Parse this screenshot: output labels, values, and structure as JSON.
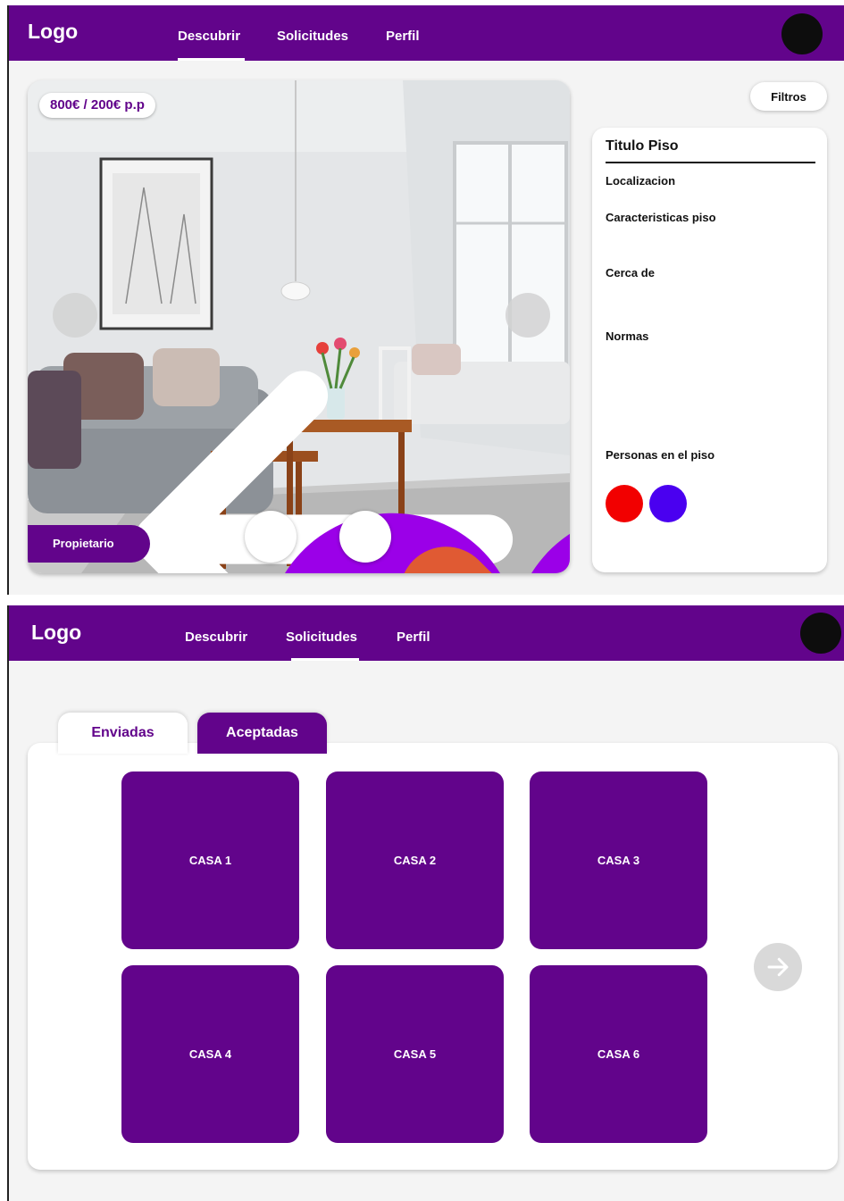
{
  "screen1": {
    "header": {
      "logo": "Logo",
      "tabs": [
        {
          "label": "Descubrir",
          "active": true
        },
        {
          "label": "Solicitudes",
          "active": false
        },
        {
          "label": "Perfil",
          "active": false
        }
      ]
    },
    "listing": {
      "price": "800€ / 200€ p.p",
      "owner_label": "Propietario",
      "like_icon": "heart-icon",
      "dislike_icon": "close-icon"
    },
    "filters_label": "Filtros",
    "details": {
      "title": "Titulo Piso",
      "location": "Localizacion",
      "features": "Caracteristicas piso",
      "nearby": "Cerca de",
      "rules": "Normas",
      "people": "Personas en el piso",
      "people_colors": [
        "#f20000",
        "#4a00f0"
      ]
    }
  },
  "screen2": {
    "header": {
      "logo": "Logo",
      "tabs": [
        {
          "label": "Descubrir",
          "active": false
        },
        {
          "label": "Solicitudes",
          "active": true
        },
        {
          "label": "Perfil",
          "active": false
        }
      ]
    },
    "subtabs": [
      {
        "label": "Enviadas",
        "active": true
      },
      {
        "label": "Aceptadas",
        "active": false
      }
    ],
    "houses": [
      "CASA 1",
      "CASA 2",
      "CASA 3",
      "CASA 4",
      "CASA 5",
      "CASA 6"
    ]
  },
  "colors": {
    "brand": "#62048b",
    "like": "#9b00e8",
    "dislike": "#e05a33",
    "arrow_bg": "#d6d6d6"
  }
}
